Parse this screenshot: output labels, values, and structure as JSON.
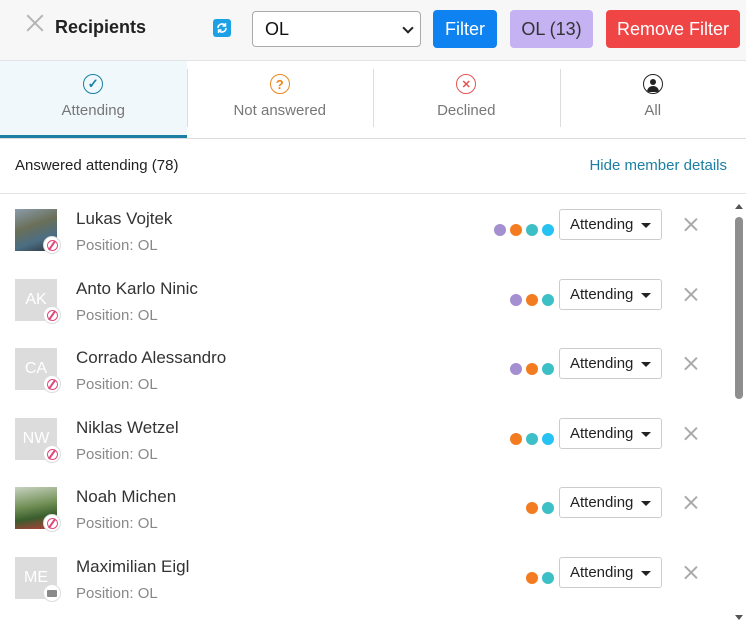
{
  "header": {
    "title": "Recipients",
    "select_value": "OL",
    "filter_label": "Filter",
    "group_label": "OL (13)",
    "remove_filter_label": "Remove Filter"
  },
  "tabs": [
    {
      "label": "Attending",
      "icon": "check-circle-icon",
      "glyph": "✓",
      "color": "#1a7fa3"
    },
    {
      "label": "Not answered",
      "icon": "question-circle-icon",
      "glyph": "?",
      "color": "#e8871e"
    },
    {
      "label": "Declined",
      "icon": "x-circle-icon",
      "glyph": "✕",
      "color": "#e25555"
    },
    {
      "label": "All",
      "icon": "person-circle-icon",
      "glyph": "●",
      "color": "#222222"
    }
  ],
  "summary": {
    "text": "Answered attending (78)",
    "hide_link": "Hide member details"
  },
  "colors": {
    "purple": "#a48fd0",
    "orange": "#f47c20",
    "teal": "#3dbfc6",
    "cyan": "#27c2f2"
  },
  "members": [
    {
      "name": "Lukas Vojtek",
      "position": "Position: OL",
      "initials": "",
      "badge": "ball-icon",
      "status": "Attending",
      "dots": [
        "purple",
        "orange",
        "teal",
        "cyan"
      ]
    },
    {
      "name": "Anto Karlo Ninic",
      "position": "Position: OL",
      "initials": "AK",
      "badge": "ball-icon",
      "status": "Attending",
      "dots": [
        "purple",
        "orange",
        "teal"
      ]
    },
    {
      "name": "Corrado Alessandro",
      "position": "Position: OL",
      "initials": "CA",
      "badge": "ball-icon",
      "status": "Attending",
      "dots": [
        "purple",
        "orange",
        "teal"
      ]
    },
    {
      "name": "Niklas Wetzel",
      "position": "Position: OL",
      "initials": "NW",
      "badge": "ball-icon",
      "status": "Attending",
      "dots": [
        "orange",
        "teal",
        "cyan"
      ]
    },
    {
      "name": "Noah Michen",
      "position": "Position: OL",
      "initials": "",
      "badge": "ball-icon",
      "status": "Attending",
      "dots": [
        "orange",
        "teal"
      ]
    },
    {
      "name": "Maximilian Eigl",
      "position": "Position: OL",
      "initials": "ME",
      "badge": "mail-icon",
      "status": "Attending",
      "dots": [
        "orange",
        "teal"
      ]
    }
  ]
}
